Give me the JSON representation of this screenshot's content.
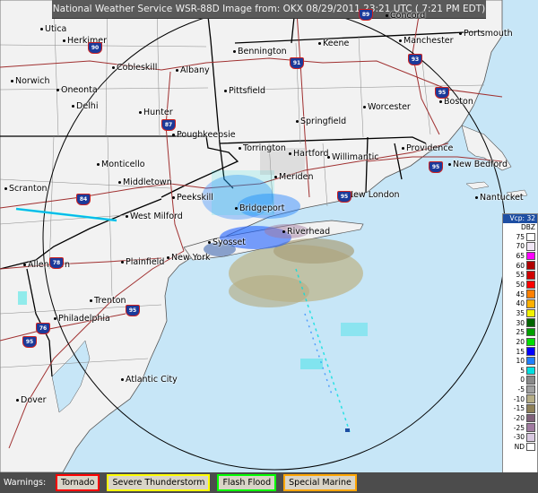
{
  "header": {
    "title": "National Weather Service WSR-88D Image from: OKX 08/29/2011 23:21 UTC ( 7:21 PM EDT)"
  },
  "legend": {
    "vcp": "Vcp: 32",
    "unit": "DBZ",
    "rows": [
      {
        "label": "75",
        "color": "#ffffff"
      },
      {
        "label": "70",
        "color": "#f0e6f5"
      },
      {
        "label": "65",
        "color": "#ff00ff"
      },
      {
        "label": "60",
        "color": "#b00000"
      },
      {
        "label": "55",
        "color": "#d00000"
      },
      {
        "label": "50",
        "color": "#ff0000"
      },
      {
        "label": "45",
        "color": "#ff8000"
      },
      {
        "label": "40",
        "color": "#ffb000"
      },
      {
        "label": "35",
        "color": "#f2f200"
      },
      {
        "label": "30",
        "color": "#006400"
      },
      {
        "label": "25",
        "color": "#00a000"
      },
      {
        "label": "20",
        "color": "#00e000"
      },
      {
        "label": "15",
        "color": "#0000ff"
      },
      {
        "label": "10",
        "color": "#2080ff"
      },
      {
        "label": "5",
        "color": "#00e0e0"
      },
      {
        "label": "0",
        "color": "#8a8a8a"
      },
      {
        "label": "-5",
        "color": "#a0a0a0"
      },
      {
        "label": "-10",
        "color": "#b5ad86"
      },
      {
        "label": "-15",
        "color": "#8e8058"
      },
      {
        "label": "-20",
        "color": "#80607a"
      },
      {
        "label": "-25",
        "color": "#a07aa0"
      },
      {
        "label": "-30",
        "color": "#d8c8e0"
      },
      {
        "label": "ND",
        "color": "#ffffff"
      }
    ]
  },
  "warnings": {
    "label": "Warnings:",
    "items": [
      {
        "label": "Tornado",
        "color": "#ff0000"
      },
      {
        "label": "Severe Thunderstorm",
        "color": "#ffff00"
      },
      {
        "label": "Flash Flood",
        "color": "#00ff00"
      },
      {
        "label": "Special Marine",
        "color": "#ffa500"
      }
    ]
  },
  "cities": [
    {
      "name": "Utica"
    },
    {
      "name": "Herkimer"
    },
    {
      "name": "Concord"
    },
    {
      "name": "Portsmouth"
    },
    {
      "name": "Manchester"
    },
    {
      "name": "Keene"
    },
    {
      "name": "Bennington"
    },
    {
      "name": "Cobleskill"
    },
    {
      "name": "Albany"
    },
    {
      "name": "Norwich"
    },
    {
      "name": "Oneonta"
    },
    {
      "name": "Delhi"
    },
    {
      "name": "Pittsfield"
    },
    {
      "name": "Worcester"
    },
    {
      "name": "Boston"
    },
    {
      "name": "Hunter"
    },
    {
      "name": "Springfield"
    },
    {
      "name": "Poughkeepsie"
    },
    {
      "name": "Torrington"
    },
    {
      "name": "Hartford"
    },
    {
      "name": "Willimantic"
    },
    {
      "name": "Providence"
    },
    {
      "name": "New Bedford"
    },
    {
      "name": "Monticello"
    },
    {
      "name": "Middletown"
    },
    {
      "name": "Meriden"
    },
    {
      "name": "New London"
    },
    {
      "name": "Nantucket"
    },
    {
      "name": "Scranton"
    },
    {
      "name": "Peekskill"
    },
    {
      "name": "West Milford"
    },
    {
      "name": "Bridgeport"
    },
    {
      "name": "Riverhead"
    },
    {
      "name": "Syosset"
    },
    {
      "name": "Allentown"
    },
    {
      "name": "Plainfield"
    },
    {
      "name": "New York"
    },
    {
      "name": "Trenton"
    },
    {
      "name": "Philadelphia"
    },
    {
      "name": "Atlantic City"
    },
    {
      "name": "Dover"
    }
  ],
  "highways": [
    {
      "label": "90"
    },
    {
      "label": "91"
    },
    {
      "label": "93"
    },
    {
      "label": "95"
    },
    {
      "label": "87"
    },
    {
      "label": "84"
    },
    {
      "label": "95"
    },
    {
      "label": "95"
    },
    {
      "label": "95"
    },
    {
      "label": "78"
    },
    {
      "label": "76"
    },
    {
      "label": "95"
    },
    {
      "label": "89"
    }
  ]
}
